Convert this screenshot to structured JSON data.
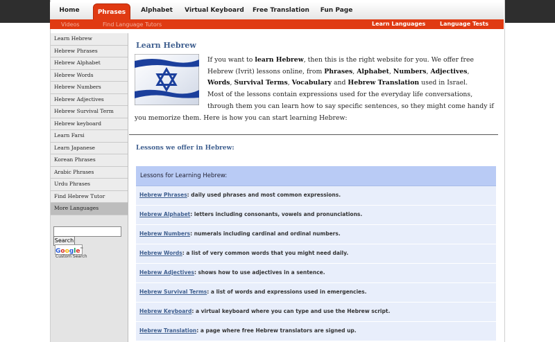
{
  "nav": {
    "items": [
      {
        "label": "Home"
      },
      {
        "label": "Phrases",
        "active": true
      },
      {
        "label": "Alphabet"
      },
      {
        "label": "Virtual Keyboard"
      },
      {
        "label": "Free Translation"
      },
      {
        "label": "Fun Page"
      }
    ]
  },
  "subnav": {
    "ghost_left": "Videos",
    "ghost_right": "Find Language Tutors",
    "links": [
      {
        "label": "Learn Languages"
      },
      {
        "label": "Language Tests"
      }
    ]
  },
  "sidebar": {
    "items": [
      {
        "label": "Learn Hebrew"
      },
      {
        "label": "Hebrew Phrases"
      },
      {
        "label": "Hebrew Alphabet"
      },
      {
        "label": "Hebrew Words"
      },
      {
        "label": "Hebrew Numbers"
      },
      {
        "label": "Hebrew Adjectives"
      },
      {
        "label": "Hebrew Survival Term"
      },
      {
        "label": "Hebrew keyboard"
      },
      {
        "label": "Learn Farsi"
      },
      {
        "label": "Learn Japanese"
      },
      {
        "label": "Korean Phrases"
      },
      {
        "label": "Arabic Phrases"
      },
      {
        "label": "Urdu Phrases"
      },
      {
        "label": "Find Hebrew Tutor"
      },
      {
        "label": "More Languages"
      }
    ],
    "search": {
      "value": "",
      "button": "Search",
      "logo": "Google™",
      "caption": "Custom Search"
    }
  },
  "main": {
    "title": "Learn Hebrew",
    "flag_icon": "israel-flag-icon",
    "intro": {
      "p1_a": "If you want to ",
      "p1_b": "learn Hebrew",
      "p1_c": ", then this is the right website for you. We offer free Hebrew (Ivrit) lessons online, from ",
      "k1": "Phrases",
      "k2": "Alphabet",
      "k3": "Numbers",
      "k4": "Adjectives",
      "k5": "Words",
      "k6": "Survival Terms",
      "k7": "Vocabulary",
      "k8": "Hebrew Translation",
      "sep1": ", ",
      "and": " and ",
      "used": " used in Israel.",
      "p2": "Most of the lessons contain expressions used for the everyday life conversations, through them you can learn how to say specific sentences, so they might come handy if you memorize them. Here is how you can start learning Hebrew:"
    },
    "lessons_heading": "Lessons we offer in Hebrew:",
    "lessons_table_header": "Lessons for Learning Hebrew:",
    "lessons": [
      {
        "link": "Hebrew Phrases",
        "desc": ": daily used phrases and most common expressions."
      },
      {
        "link": "Hebrew Alphabet",
        "desc": ": letters including consonants, vowels and pronunciations."
      },
      {
        "link": "Hebrew Numbers",
        "desc": ": numerals including cardinal and ordinal numbers."
      },
      {
        "link": "Hebrew Words",
        "desc": ": a list of very common words that you might need daily."
      },
      {
        "link": "Hebrew Adjectives",
        "desc": ": shows how to use adjectives in a sentence."
      },
      {
        "link": "Hebrew Survival Terms",
        "desc": ": a list of words and expressions used in emergencies."
      },
      {
        "link": "Hebrew Keyboard",
        "desc": ": a virtual keyboard where you can type and use the Hebrew script."
      },
      {
        "link": "Hebrew Translation",
        "desc": ": a page where free Hebrew translators are signed up."
      }
    ]
  },
  "colors": {
    "accent": "#e03a12",
    "heading": "#3f5f8f",
    "table_header": "#b9cbf5",
    "row": "#e8eefb"
  }
}
